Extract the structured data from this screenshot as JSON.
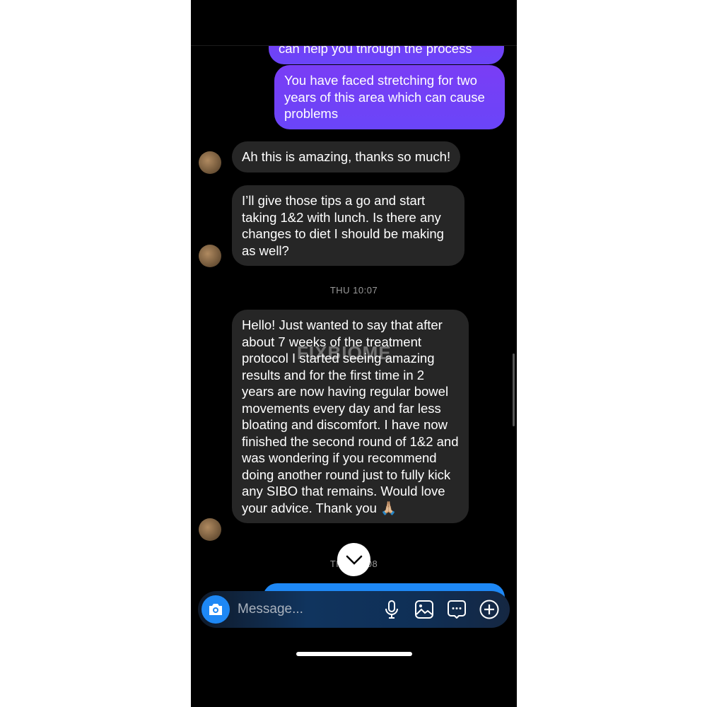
{
  "messages": [
    {
      "dir": "out",
      "text": "can help you through the process"
    },
    {
      "dir": "out",
      "text": "You have faced stretching for two years of this area which can cause problems"
    },
    {
      "dir": "in",
      "text": "Ah this is amazing, thanks so much!"
    },
    {
      "dir": "in",
      "text": "I’ll give those tips a go and start taking 1&2 with lunch. Is there any changes to diet I should be making as well?"
    },
    {
      "dir": "in",
      "text": "Hello! Just wanted to say that after about 7 weeks of the treatment protocol I started seeing amazing results and for the first time in 2 years are now having regular bowel movements every day and far less bloating and discomfort. I have now finished the second round of 1&2 and was wondering if you recommend doing another round just to fully kick any SIBO that remains. Would love your advice. Thank you 🙏🏼"
    }
  ],
  "timestamps": [
    "THU 10:07",
    "THU 10:08"
  ],
  "watermark": "FIXBIOME",
  "composer": {
    "placeholder": "Message..."
  },
  "colors": {
    "outgoing": "#6a45f8",
    "incoming": "#262626",
    "accent": "#1e88f5"
  }
}
